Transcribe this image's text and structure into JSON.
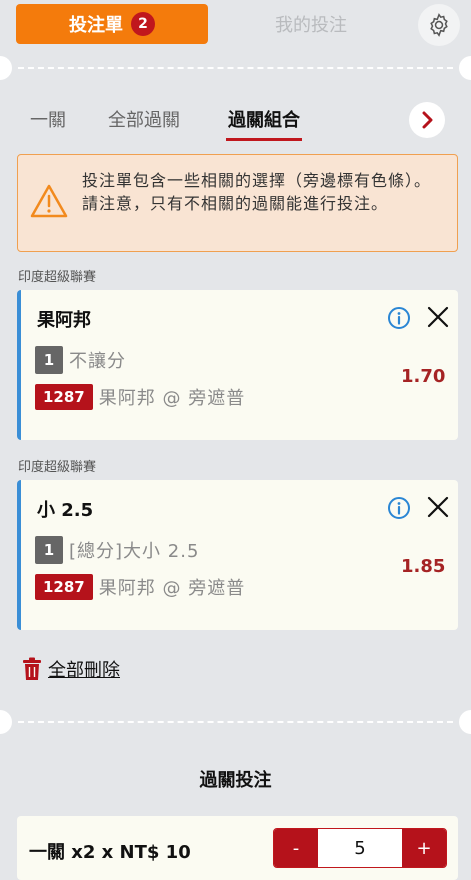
{
  "top_tabs": {
    "active_label": "投注單",
    "badge_count": "2",
    "inactive_label": "我的投注"
  },
  "sub_tabs": [
    {
      "label": "一關",
      "active": false
    },
    {
      "label": "全部過關",
      "active": false
    },
    {
      "label": "過關組合",
      "active": true
    }
  ],
  "warning": {
    "text": "投注單包含一些相關的選擇（旁邊標有色條）。請注意，只有不相關的過關能進行投注。"
  },
  "selections": [
    {
      "league": "印度超級聯賽",
      "title": "果阿邦",
      "line_number": "1",
      "market": "不讓分",
      "event_code": "1287",
      "matchup": "果阿邦 @ 旁遮普",
      "odds": "1.70"
    },
    {
      "league": "印度超級聯賽",
      "title": "小 2.5",
      "line_number": "1",
      "market": "[總分]大小 2.5",
      "event_code": "1287",
      "matchup": "果阿邦 @ 旁遮普",
      "odds": "1.85"
    }
  ],
  "delete_all_label": "全部刪除",
  "parlay_title": "過關投注",
  "stake": {
    "label": "一關 x2 x NT$ 10",
    "minus": "-",
    "value": "5",
    "plus": "+"
  },
  "colors": {
    "accent_orange": "#f47b0c",
    "brand_red": "#b5121b",
    "related_bar_blue": "#3a8ed6"
  },
  "icons": [
    "settings-gear-icon",
    "chevron-right-icon",
    "warning-triangle-icon",
    "info-icon",
    "close-icon",
    "trash-icon"
  ]
}
